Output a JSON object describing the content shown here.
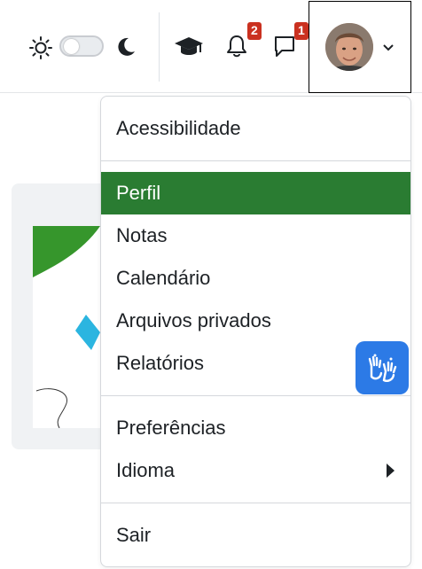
{
  "navbar": {
    "icons": {
      "light_mode": "sun-icon",
      "dark_mode": "moon-icon",
      "courses": "graduation-cap-icon",
      "notifications": "bell-icon",
      "messages": "chat-bubble-icon",
      "user_menu": "chevron-down-icon"
    },
    "notifications_count": "2",
    "messages_count": "1",
    "theme_toggle_on": false
  },
  "menu": {
    "items": [
      {
        "label": "Acessibilidade"
      },
      {
        "label": "Perfil",
        "active": true
      },
      {
        "label": "Notas"
      },
      {
        "label": "Calendário"
      },
      {
        "label": "Arquivos privados"
      },
      {
        "label": "Relatórios"
      },
      {
        "label": "Preferências"
      },
      {
        "label": "Idioma",
        "has_submenu": true
      },
      {
        "label": "Sair"
      }
    ]
  },
  "widgets": {
    "accessibility_icon": "sign-language-hands-icon"
  },
  "colors": {
    "active_item": "#2a7c32",
    "badge": "#ca3120",
    "a11y_widget": "#2c7ae6"
  }
}
